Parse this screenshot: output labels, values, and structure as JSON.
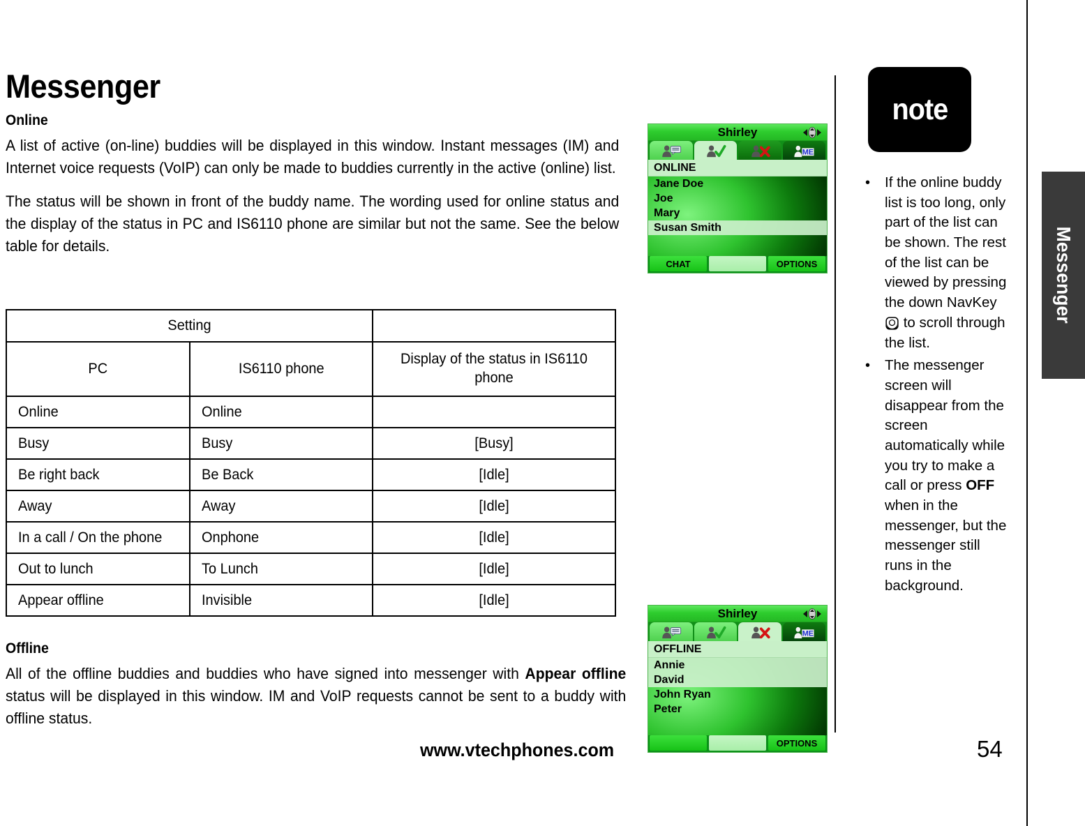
{
  "document": {
    "page_title": "Messenger",
    "footer_url": "www.vtechphones.com",
    "page_number": "54",
    "side_tab_label": "Messenger"
  },
  "sections": {
    "online": {
      "heading": "Online",
      "paragraph_1": "A list of active (on-line) buddies will be displayed in this window. Instant messages (IM) and Internet voice requests (VoIP) can only be made to buddies currently in the active (online) list.",
      "paragraph_2": "The status will be shown in front of the buddy name. The wording used for online status and the display of the status in PC and IS6110 phone are similar but not the same. See the below table for details."
    },
    "offline": {
      "heading": "Offline",
      "paragraph_part1": "All of the offline buddies and buddies who have signed into messenger with ",
      "paragraph_bold": "Appear offline",
      "paragraph_part2": " status will be displayed in this window. IM and VoIP requests cannot be sent to a buddy with offline status."
    }
  },
  "status_table": {
    "group_header": "Setting",
    "group_header_blank": "",
    "columns": [
      "PC",
      "IS6110  phone",
      "Display of the status in IS6110 phone"
    ],
    "rows": [
      {
        "pc": "Online",
        "phone": "Online",
        "display": ""
      },
      {
        "pc": "Busy",
        "phone": "Busy",
        "display": "[Busy]"
      },
      {
        "pc": "Be right back",
        "phone": "Be Back",
        "display": "[Idle]"
      },
      {
        "pc": "Away",
        "phone": "Away",
        "display": "[Idle]"
      },
      {
        "pc": "In a call / On the phone",
        "phone": "Onphone",
        "display": "[Idle]"
      },
      {
        "pc": "Out to lunch",
        "phone": "To Lunch",
        "display": "[Idle]"
      },
      {
        "pc": "Appear offline",
        "phone": "Invisible",
        "display": "[Idle]"
      }
    ]
  },
  "phone_online": {
    "title": "Shirley",
    "nav_icon": "four-way-navigation-icon",
    "tabs": [
      {
        "name": "chat-tab",
        "icon": "person-message-icon",
        "active": false
      },
      {
        "name": "online-tab",
        "icon": "person-check-icon",
        "active": true
      },
      {
        "name": "offline-tab",
        "icon": "person-x-icon",
        "active": false
      },
      {
        "name": "me-tab",
        "icon": "person-me-icon",
        "label": "ME",
        "active": false
      }
    ],
    "section_label": "ONLINE",
    "buddies": [
      {
        "name": "Jane Doe",
        "highlight": false
      },
      {
        "name": "Joe",
        "highlight": false
      },
      {
        "name": "Mary",
        "highlight": false
      },
      {
        "name": "Susan Smith",
        "highlight": true
      }
    ],
    "softkeys": {
      "left": "CHAT",
      "middle": "",
      "right": "OPTIONS"
    }
  },
  "phone_offline": {
    "title": "Shirley",
    "nav_icon": "four-way-navigation-icon",
    "tabs": [
      {
        "name": "chat-tab",
        "icon": "person-message-icon",
        "active": false
      },
      {
        "name": "online-tab",
        "icon": "person-check-icon",
        "active": false
      },
      {
        "name": "offline-tab",
        "icon": "person-x-icon",
        "active": true
      },
      {
        "name": "me-tab",
        "icon": "person-me-icon",
        "label": "ME",
        "active": false
      }
    ],
    "section_label": "OFFLINE",
    "buddies": [
      {
        "name": "Annie",
        "highlight": true
      },
      {
        "name": "David",
        "highlight": true
      },
      {
        "name": "John Ryan",
        "highlight": false
      },
      {
        "name": "Peter",
        "highlight": false
      }
    ],
    "softkeys": {
      "left": "",
      "middle": "",
      "right": "OPTIONS"
    }
  },
  "note": {
    "badge_label": "note",
    "items": [
      {
        "text_before_icon": "If the online buddy list is too long, only part of the list can be shown. The rest of the list can be viewed by pressing the down NavKey ",
        "icon": "navkey-down-icon",
        "text_after_icon": " to scroll through the list."
      },
      {
        "text_before_bold": "The messenger screen will disappear from the screen automatically while you try to make a call or press ",
        "bold": "OFF",
        "text_after_bold": " when in the messenger, but the messenger still runs in the background."
      }
    ]
  },
  "colors": {
    "phone_green_light": "#5ee85e",
    "phone_green_dark": "#0b6d0b",
    "section_bar": "#c8f0c8",
    "note_badge_bg": "#000000",
    "side_tab_bg": "#3a3a3a",
    "check_green": "#1faa28",
    "x_red": "#d41414",
    "me_blue": "#1d2fd0"
  }
}
